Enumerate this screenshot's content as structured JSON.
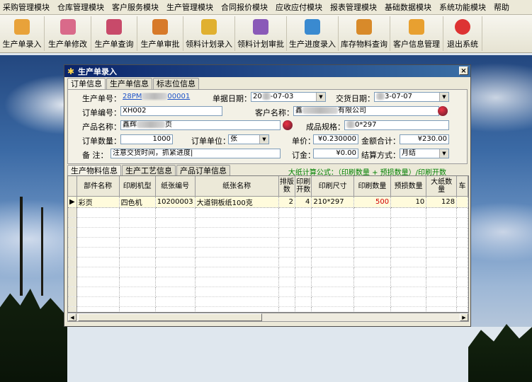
{
  "menu": [
    "采购管理模块",
    "仓库管理模块",
    "客户服务模块",
    "生产管理模块",
    "合同报价模块",
    "应收应付模块",
    "报表管理模块",
    "基础数据模块",
    "系统功能模块",
    "帮助"
  ],
  "toolbar": [
    {
      "label": "生产单录入",
      "icon": "production-entry-icon",
      "color": "#e8a23a"
    },
    {
      "label": "生产单修改",
      "icon": "production-edit-icon",
      "color": "#d96a8a"
    },
    {
      "label": "生产单查询",
      "icon": "production-query-icon",
      "color": "#c84a6a"
    },
    {
      "label": "生产单审批",
      "icon": "production-approve-icon",
      "color": "#d77a2a"
    },
    {
      "label": "领料计划录入",
      "icon": "material-plan-icon",
      "color": "#e0b030"
    },
    {
      "label": "领料计划审批",
      "icon": "material-approve-icon",
      "color": "#8a5ab8"
    },
    {
      "label": "生产进度录入",
      "icon": "progress-entry-icon",
      "color": "#3a8ad0"
    },
    {
      "label": "库存物料查询",
      "icon": "inventory-query-icon",
      "color": "#d88a2a"
    },
    {
      "label": "客户信息管理",
      "icon": "customer-info-icon",
      "color": "#e8a030"
    },
    {
      "label": "退出系统",
      "icon": "exit-icon",
      "color": "#d33"
    }
  ],
  "window": {
    "title": "生产单录入",
    "close": "×",
    "tabs": [
      "订单信息",
      "生产单信息",
      "标志位信息"
    ],
    "form": {
      "prod_no_label": "生产单号：",
      "prod_no_value_a": "28PM",
      "prod_no_value_b": "00001",
      "doc_date_label": "单据日期：",
      "doc_date_value_a": "20",
      "doc_date_value_b": "-07-03",
      "delivery_label": "交货日期：",
      "delivery_value_b": "3-07-07",
      "order_no_label": "订单编号：",
      "order_no_value": "XH002",
      "customer_label": "客户名称：",
      "customer_value_a": "鑫",
      "customer_value_b": "有限公司",
      "product_label": "产品名称：",
      "product_value_a": "鑫辉",
      "product_value_b": "页",
      "spec_label": "成品规格：",
      "spec_value_b": "0*297",
      "qty_label": "订单数量：",
      "qty_value": "1000",
      "unit_label": "订单单位：",
      "unit_value": "张",
      "price_label": "单价：",
      "price_value": "¥0.230000",
      "total_label": "金额合计：",
      "total_value": "¥230.00",
      "remark_label": "备  注：",
      "remark_value": "注意交货时间，抓紧进度|",
      "deposit_label": "订金：",
      "deposit_value": "¥0.00",
      "settle_label": "结算方式：",
      "settle_value": "月结"
    },
    "subtabs": [
      "生产物料信息",
      "生产工艺信息",
      "产品订单信息"
    ],
    "formula": "大纸计算公式：（印刷数量 + 预损数量）/印刷开数",
    "columns": [
      "部件名称",
      "印刷机型",
      "纸张编号",
      "纸张名称",
      "排版数",
      "印刷开数",
      "印刷尺寸",
      "印刷数量",
      "预损数量",
      "大纸数量",
      "车"
    ],
    "rows": [
      {
        "part": "彩页",
        "machine": "四色机",
        "paper_no": "10200003",
        "paper_name": "大道铜板纸100克",
        "layout": "2",
        "open": "4",
        "size": "210*297",
        "print_qty": "500",
        "waste": "10",
        "big": "128"
      }
    ],
    "accent_red": "#d00000"
  }
}
